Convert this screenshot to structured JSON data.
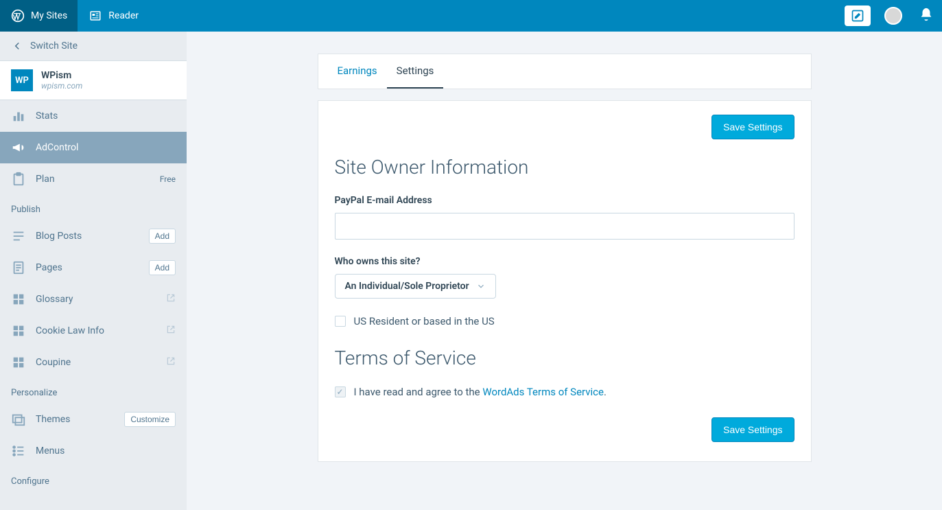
{
  "masterbar": {
    "my_sites": "My Sites",
    "reader": "Reader"
  },
  "sidebar": {
    "switch_site": "Switch Site",
    "site": {
      "title": "WPism",
      "domain": "wpism.com",
      "icon_text": "WP"
    },
    "items_top": [
      {
        "label": "Stats"
      },
      {
        "label": "AdControl",
        "selected": true
      },
      {
        "label": "Plan",
        "extra": "Free"
      }
    ],
    "section_publish": "Publish",
    "items_publish": [
      {
        "label": "Blog Posts",
        "btn": "Add"
      },
      {
        "label": "Pages",
        "btn": "Add"
      },
      {
        "label": "Glossary",
        "external": true
      },
      {
        "label": "Cookie Law Info",
        "external": true
      },
      {
        "label": "Coupine",
        "external": true
      }
    ],
    "section_personalize": "Personalize",
    "items_personalize": [
      {
        "label": "Themes",
        "btn": "Customize"
      },
      {
        "label": "Menus"
      }
    ],
    "section_configure": "Configure"
  },
  "tabs": {
    "earnings": "Earnings",
    "settings": "Settings"
  },
  "settings": {
    "save_button": "Save Settings",
    "section1_title": "Site Owner Information",
    "paypal_label": "PayPal E-mail Address",
    "paypal_value": "",
    "owner_label": "Who owns this site?",
    "owner_value": "An Individual/Sole Proprietor",
    "us_resident_label": "US Resident or based in the US",
    "section2_title": "Terms of Service",
    "tos_prefix": "I have read and agree to the ",
    "tos_link": "WordAds Terms of Service",
    "tos_suffix": "."
  }
}
